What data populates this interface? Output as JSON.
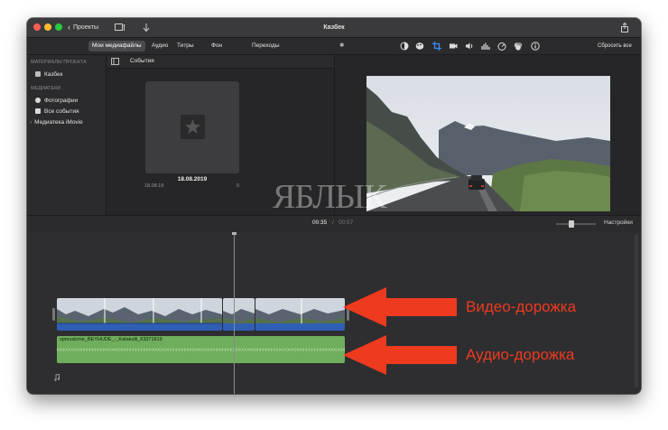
{
  "window": {
    "title": "Казбек",
    "back_label": "Проекты"
  },
  "browser_tabs": [
    "Мои медиафайлы",
    "Аудио",
    "Титры",
    "Фон",
    "Переходы"
  ],
  "reset_label": "Сбросить все",
  "library": {
    "project_heading": "МАТЕРИАЛЫ ПРОЕКТА",
    "project_item": "Казбек",
    "libraries_heading": "МЕДИАТЕКИ",
    "items": [
      "Фотографии",
      "Все события",
      "Медиатека iMovie"
    ]
  },
  "browser": {
    "events_label": "События",
    "event": {
      "date": "18.08.2019",
      "short_date": "18.08.19",
      "count": "0"
    }
  },
  "timeline": {
    "current_time": "00:35",
    "separator": "/",
    "total_time": "00:57",
    "settings_label": "Настройки",
    "audio_clip_name": "vpmusicme_BEYHUDE_-_Katakulli_63371819"
  },
  "annotations": {
    "video_track": "Видео-дорожка",
    "audio_track": "Аудио-дорожка",
    "arrow_color": "#ee3a1f"
  },
  "watermark": "ЯБЛЫК",
  "colors": {
    "audio_track": "#6fae5c",
    "video_track_bar": "#2f5fb5",
    "window_bg": "#2b2b2d"
  }
}
